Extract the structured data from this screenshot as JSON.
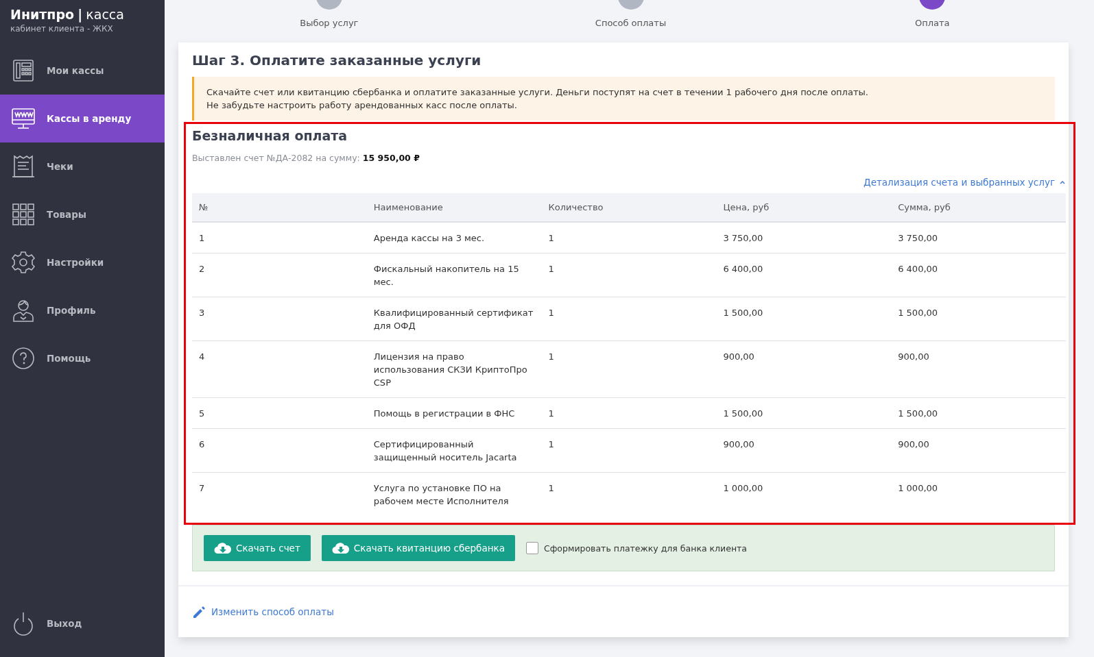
{
  "sidebar": {
    "logo_brand": "Инитпро",
    "logo_separator": "|",
    "logo_product": "касса",
    "subtitle": "кабинет клиента - ЖКХ",
    "items": [
      {
        "label": "Мои кассы",
        "kind": "phone",
        "selected": false
      },
      {
        "label": "Кассы в аренду",
        "kind": "monitor",
        "selected": true
      },
      {
        "label": "Чеки",
        "kind": "receipt",
        "selected": false
      },
      {
        "label": "Товары",
        "kind": "grid",
        "selected": false
      },
      {
        "label": "Настройки",
        "kind": "gear",
        "selected": false
      },
      {
        "label": "Профиль",
        "kind": "person",
        "selected": false
      },
      {
        "label": "Помощь",
        "kind": "help",
        "selected": false
      }
    ],
    "logout": "Выход"
  },
  "steps": [
    {
      "label": "Выбор услуг",
      "selected": false
    },
    {
      "label": "Способ оплаты",
      "selected": false
    },
    {
      "label": "Оплата",
      "selected": true
    }
  ],
  "page_title": "Шаг 3. Оплатите заказанные услуги",
  "notice": [
    "Скачайте счет или квитанцию сбербанка и оплатите заказанные услуги. Деньги поступят на счет в течении 1 рабочего дня после оплаты.",
    "Не забудьте настроить работу арендованных касс после оплаты."
  ],
  "payment": {
    "title": "Безналичная оплата",
    "invoice_text": "Выставлен счет №ДА-2082 на сумму:",
    "invoice_sum": "15 950,00 ₽",
    "details_link": "Детализация счета и выбранных услуг",
    "details_expanded": true
  },
  "table": {
    "columns": [
      "№",
      "Наименование",
      "Количество",
      "Цена, руб",
      "Сумма, руб"
    ],
    "rows": [
      [
        "1",
        "Аренда кассы на 3 мес.",
        "1",
        "3 750,00",
        "3 750,00"
      ],
      [
        "2",
        "Фискальный накопитель на 15 мес.",
        "1",
        "6 400,00",
        "6 400,00"
      ],
      [
        "3",
        "Квалифицированный сертификат для ОФД",
        "1",
        "1 500,00",
        "1 500,00"
      ],
      [
        "4",
        "Лицензия на право использования СКЗИ КриптоПро CSP",
        "1",
        "900,00",
        "900,00"
      ],
      [
        "5",
        "Помощь в регистрации в ФНС",
        "1",
        "1 500,00",
        "1 500,00"
      ],
      [
        "6",
        "Сертифицированный защищенный носитель Jacarta",
        "1",
        "900,00",
        "900,00"
      ],
      [
        "7",
        "Услуга по установке ПО на рабочем месте Исполнителя",
        "1",
        "1 000,00",
        "1 000,00"
      ]
    ]
  },
  "actions": {
    "buttons": [
      "Скачать счет",
      "Скачать квитанцию сбербанка"
    ],
    "checkbox": {
      "label": "Сформировать платежку для банка клиента",
      "checked": false
    }
  },
  "change_link": "Изменить способ оплаты"
}
